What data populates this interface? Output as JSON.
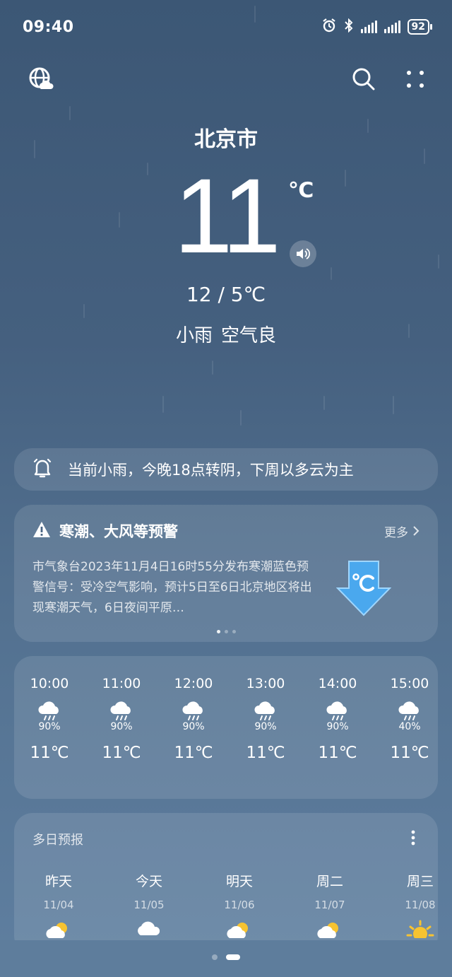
{
  "status": {
    "time": "09:40",
    "battery": "92"
  },
  "location": {
    "city": "北京市",
    "temp": "11",
    "unit": "℃",
    "range": "12 / 5℃",
    "condition": "小雨",
    "air": "空气良"
  },
  "notice": {
    "text": "当前小雨，今晚18点转阴，下周以多云为主"
  },
  "warning": {
    "title": "寒潮、大风等预警",
    "more": "更多",
    "body": "市气象台2023年11月4日16时55分发布寒潮蓝色预警信号：受冷空气影响，预计5日至6日北京地区将出现寒潮天气，6日夜间平原…"
  },
  "hourly": [
    {
      "time": "10:00",
      "precip": "90%",
      "temp": "11℃",
      "icon": "rain-cloud-icon"
    },
    {
      "time": "11:00",
      "precip": "90%",
      "temp": "11℃",
      "icon": "rain-cloud-icon"
    },
    {
      "time": "12:00",
      "precip": "90%",
      "temp": "11℃",
      "icon": "rain-cloud-icon"
    },
    {
      "time": "13:00",
      "precip": "90%",
      "temp": "11℃",
      "icon": "rain-cloud-icon"
    },
    {
      "time": "14:00",
      "precip": "90%",
      "temp": "11℃",
      "icon": "rain-cloud-icon"
    },
    {
      "time": "15:00",
      "precip": "40%",
      "temp": "11℃",
      "icon": "rain-cloud-icon"
    }
  ],
  "daily": {
    "title": "多日预报",
    "days": [
      {
        "day": "昨天",
        "date": "11/04",
        "icon": "partly-cloudy-icon"
      },
      {
        "day": "今天",
        "date": "11/05",
        "icon": "rain-cloud-icon"
      },
      {
        "day": "明天",
        "date": "11/06",
        "icon": "partly-cloudy-icon"
      },
      {
        "day": "周二",
        "date": "11/07",
        "icon": "partly-cloudy-icon"
      },
      {
        "day": "周三",
        "date": "11/08",
        "icon": "sun-icon"
      }
    ]
  },
  "colors": {
    "accent": "#4aa8ee",
    "sun": "#f7c331"
  }
}
